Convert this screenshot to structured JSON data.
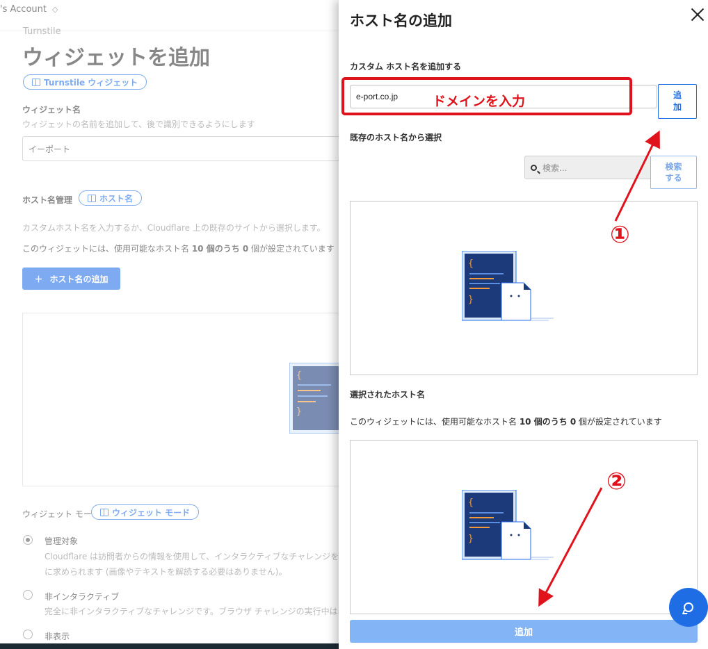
{
  "bg": {
    "account": "'s Account",
    "breadcrumb": "Turnstile",
    "title": "ウィジェットを追加",
    "turnstile_pill": "Turnstile ウィジェット",
    "widget_name_label": "ウィジェット名",
    "widget_name_hint": "ウィジェットの名前を追加して、後で識別できるようにします",
    "widget_name_value": "イーポート",
    "hostname_mgmt_label": "ホスト名管理",
    "hostname_pill": "ホスト名",
    "hostname_hint": "カスタムホスト名を入力するか、Cloudflare 上の既存のサイトから選択します。",
    "hostname_count_prefix": "このウィジェットには、使用可能なホスト名 ",
    "hostname_count_of": "10 個のうち 0",
    "hostname_count_suffix": " 個が設定されています",
    "add_hostname_button": "ホスト名の追加",
    "widget_mode_label": "ウィジェット モード",
    "widget_mode_pill": "ウィジェット モード",
    "mode_managed": "管理対象",
    "mode_managed_desc1": "Cloudflare は訪問者からの情報を使用して、インタラクティブなチャレンジを使用",
    "mode_managed_desc2": "に求められます (画像やテキストを解読する必要はありません)。",
    "mode_noninteractive": "非インタラクティブ",
    "mode_noninteractive_desc": "完全に非インタラクティブなチャレンジです。ブラウザ チャレンジの実行中は、読み",
    "mode_invisible": "非表示"
  },
  "panel": {
    "title": "ホスト名の追加",
    "custom_label": "カスタム ホスト名を追加する",
    "host_value": "e-port.co.jp",
    "add_small_line1": "追",
    "add_small_line2": "加",
    "existing_label": "既存のホスト名から選択",
    "search_placeholder": "検索...",
    "search_btn_line1": "検索",
    "search_btn_line2": "する",
    "selected_label": "選択されたホスト名",
    "count_prefix": "このウィジェットには、使用可能なホスト名 ",
    "count_of": "10 個のうち 0",
    "count_suffix": " 個が設定されています",
    "primary_button": "追加"
  },
  "annotations": {
    "enter_domain": "ドメインを入力",
    "step1": "①",
    "step2": "②",
    "color": "#e0121b"
  },
  "colors": {
    "accent": "#1f6de5",
    "primary_disabled": "#83b4f5",
    "illus_dark": "#1c3a7a"
  }
}
